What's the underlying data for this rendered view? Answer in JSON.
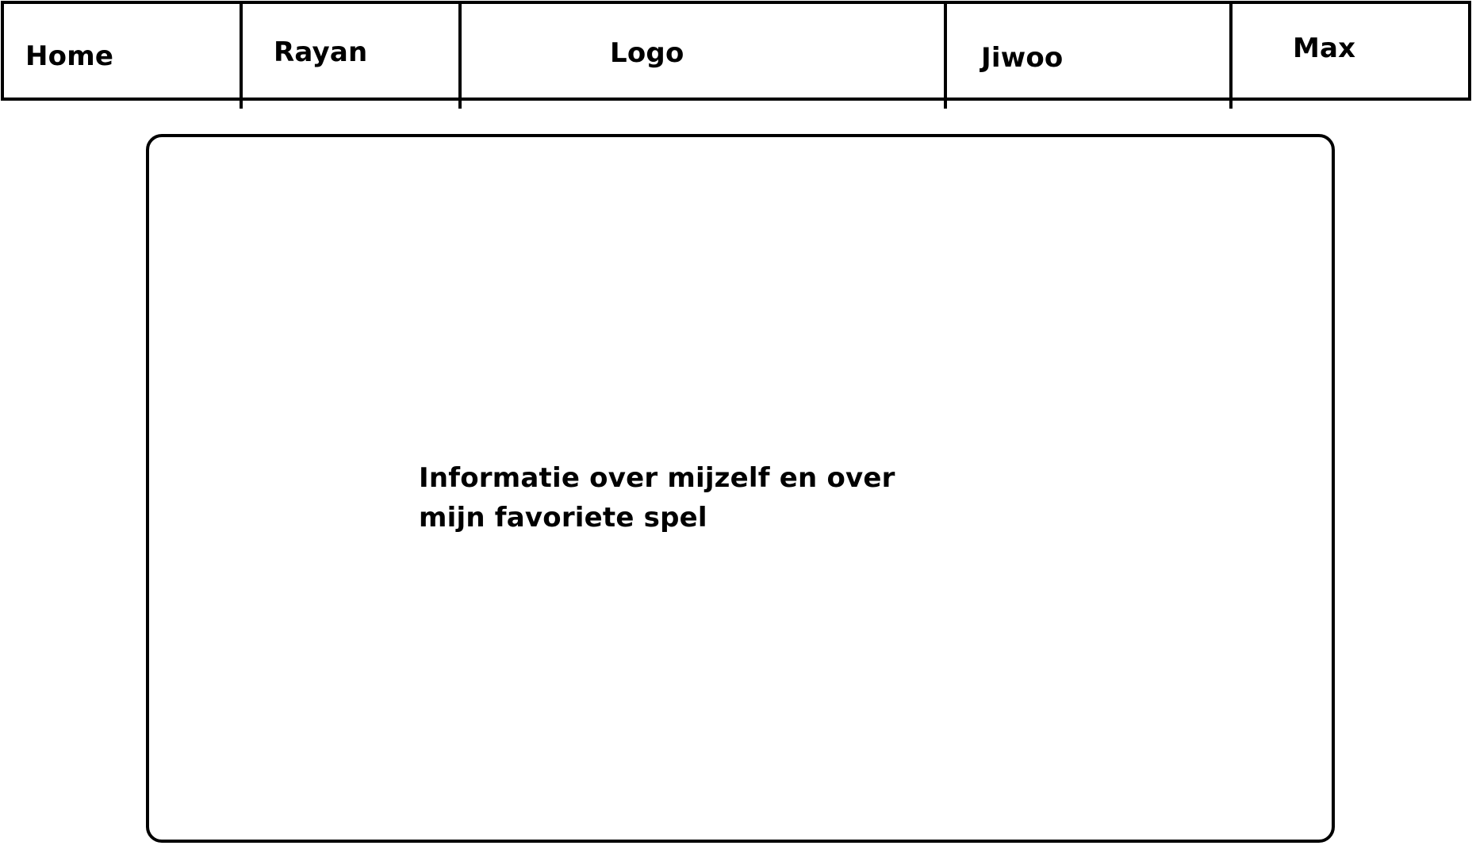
{
  "nav": {
    "items": [
      {
        "label": "Home"
      },
      {
        "label": "Rayan"
      },
      {
        "label": "Logo"
      },
      {
        "label": "Jiwoo"
      },
      {
        "label": "Max"
      }
    ]
  },
  "main": {
    "line1": "Informatie over mijzelf en over",
    "line2": "mijn favoriete spel"
  }
}
